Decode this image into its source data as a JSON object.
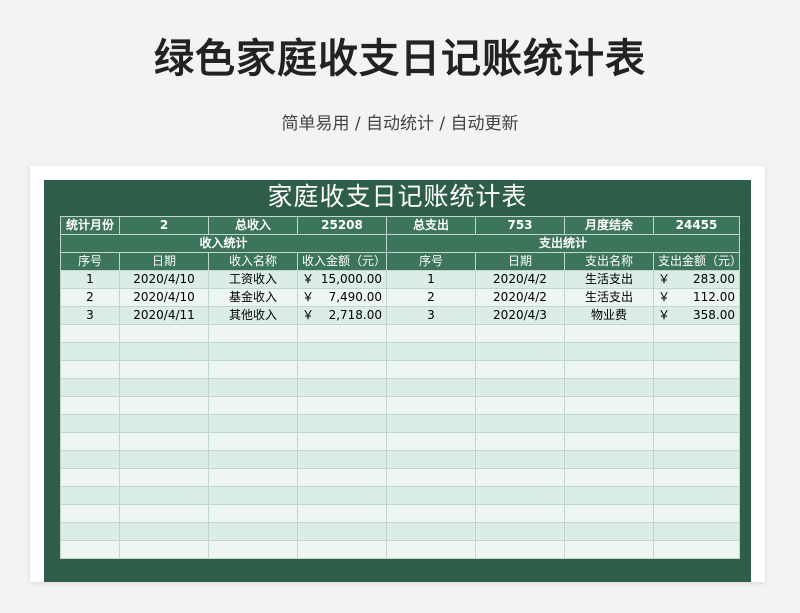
{
  "header": {
    "title": "绿色家庭收支日记账统计表",
    "subtitle": "简单易用 / 自动统计 / 自动更新"
  },
  "sheet": {
    "title": "家庭收支日记账统计表",
    "summary": {
      "month_label": "统计月份",
      "month_value": "2",
      "income_label": "总收入",
      "income_value": "25208",
      "expense_label": "总支出",
      "expense_value": "753",
      "balance_label": "月度结余",
      "balance_value": "24455"
    },
    "income_section": "收入统计",
    "expense_section": "支出统计",
    "columns": [
      "序号",
      "日期",
      "收入名称",
      "收入金额（元）",
      "序号",
      "日期",
      "支出名称",
      "支出金额（元）"
    ],
    "currency_symbol": "￥",
    "rows": [
      {
        "i_no": "1",
        "i_date": "2020/4/10",
        "i_name": "工资收入",
        "i_amt": "15,000.00",
        "e_no": "1",
        "e_date": "2020/4/2",
        "e_name": "生活支出",
        "e_amt": "283.00"
      },
      {
        "i_no": "2",
        "i_date": "2020/4/10",
        "i_name": "基金收入",
        "i_amt": "7,490.00",
        "e_no": "2",
        "e_date": "2020/4/2",
        "e_name": "生活支出",
        "e_amt": "112.00"
      },
      {
        "i_no": "3",
        "i_date": "2020/4/11",
        "i_name": "其他收入",
        "i_amt": "2,718.00",
        "e_no": "3",
        "e_date": "2020/4/3",
        "e_name": "物业费",
        "e_amt": "358.00"
      }
    ],
    "empty_row_count": 13
  }
}
